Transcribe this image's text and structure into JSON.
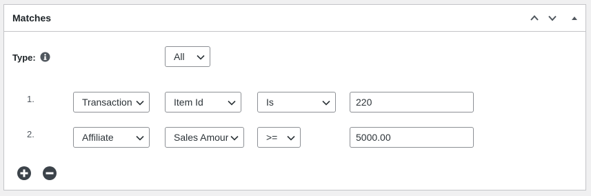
{
  "panel": {
    "title": "Matches",
    "header_icons": [
      "chevron-up-icon",
      "chevron-down-icon",
      "triangle-up-icon"
    ]
  },
  "type_row": {
    "label": "Type:",
    "icon": "info-icon",
    "value": "All"
  },
  "rules": [
    {
      "number": "1.",
      "group": "Transaction",
      "field": "Item Id",
      "operator": "Is",
      "value": "220"
    },
    {
      "number": "2.",
      "group": "Affiliate",
      "field": "Sales Amour",
      "operator": ">=",
      "value": "5000.00"
    }
  ],
  "actions": {
    "add_icon": "plus-circle-icon",
    "remove_icon": "minus-circle-icon"
  },
  "colors": {
    "border": "#c3c4c7",
    "control_border": "#8c8f94",
    "icon": "#50575e",
    "text": "#1d2327"
  }
}
